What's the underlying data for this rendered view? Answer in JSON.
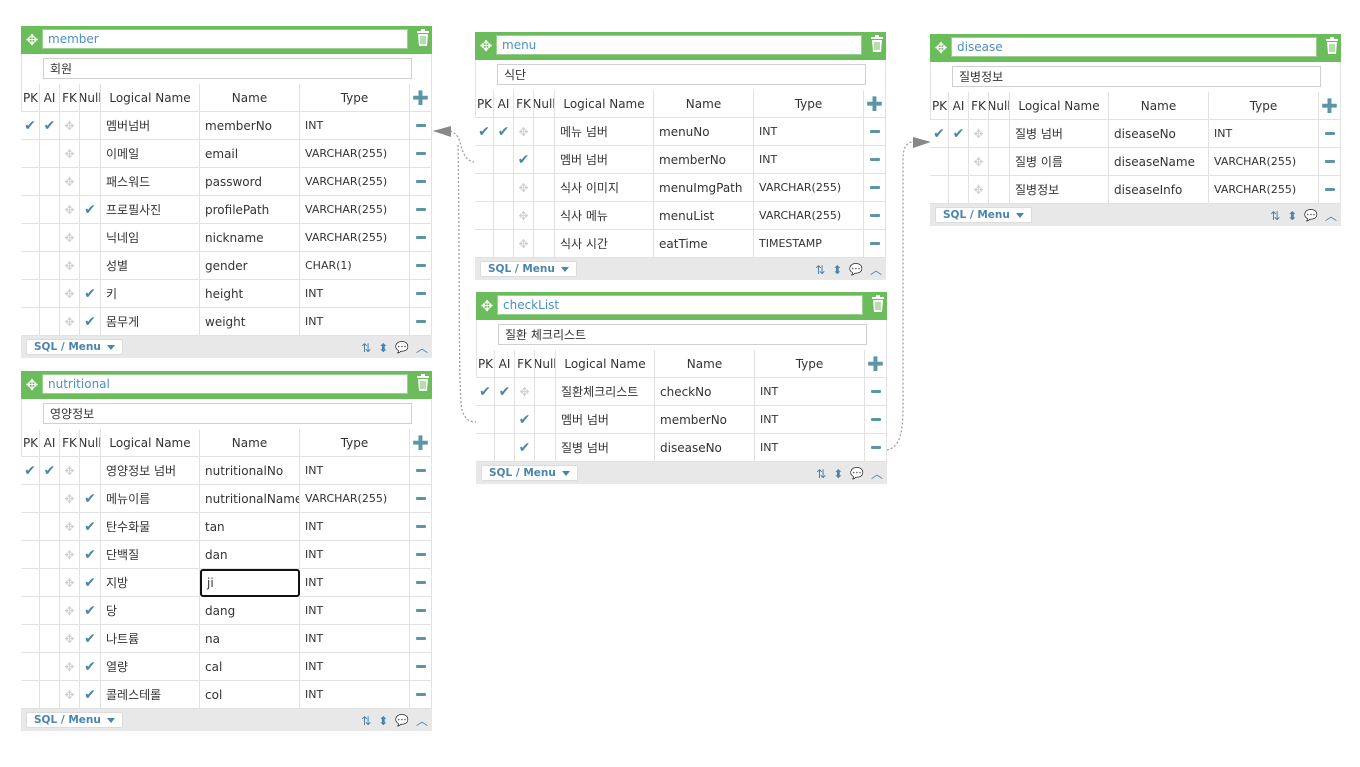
{
  "columns_header": {
    "pk": "PK",
    "ai": "AI",
    "fk": "FK",
    "null": "Null",
    "logical": "Logical Name",
    "name": "Name",
    "type": "Type"
  },
  "footer": {
    "sql_menu": "SQL / Menu"
  },
  "colors": {
    "header_green": "#6bbd5b",
    "accent_blue": "#4a86a7",
    "connector": "#999999"
  },
  "tables": [
    {
      "id": "member",
      "name": "member",
      "comment": "회원",
      "rows": [
        {
          "pk": true,
          "ai": true,
          "fk": false,
          "null": false,
          "logical": "멤버넘버",
          "name": "memberNo",
          "type": "INT"
        },
        {
          "pk": false,
          "ai": false,
          "fk": false,
          "null": false,
          "logical": "이메일",
          "name": "email",
          "type": "VARCHAR(255)"
        },
        {
          "pk": false,
          "ai": false,
          "fk": false,
          "null": false,
          "logical": "패스워드",
          "name": "password",
          "type": "VARCHAR(255)"
        },
        {
          "pk": false,
          "ai": false,
          "fk": false,
          "null": true,
          "logical": "프로필사진",
          "name": "profilePath",
          "type": "VARCHAR(255)"
        },
        {
          "pk": false,
          "ai": false,
          "fk": false,
          "null": false,
          "logical": "닉네임",
          "name": "nickname",
          "type": "VARCHAR(255)"
        },
        {
          "pk": false,
          "ai": false,
          "fk": false,
          "null": false,
          "logical": "성별",
          "name": "gender",
          "type": "CHAR(1)"
        },
        {
          "pk": false,
          "ai": false,
          "fk": false,
          "null": true,
          "logical": "키",
          "name": "height",
          "type": "INT"
        },
        {
          "pk": false,
          "ai": false,
          "fk": false,
          "null": true,
          "logical": "몸무게",
          "name": "weight",
          "type": "INT"
        }
      ]
    },
    {
      "id": "nutritional",
      "name": "nutritional",
      "comment": "영양정보",
      "rows": [
        {
          "pk": true,
          "ai": true,
          "fk": false,
          "null": false,
          "logical": "영양정보 넘버",
          "name": "nutritionalNo",
          "type": "INT"
        },
        {
          "pk": false,
          "ai": false,
          "fk": false,
          "null": true,
          "logical": "메뉴이름",
          "name": "nutritionalName",
          "type": "VARCHAR(255)"
        },
        {
          "pk": false,
          "ai": false,
          "fk": false,
          "null": true,
          "logical": "탄수화물",
          "name": "tan",
          "type": "INT"
        },
        {
          "pk": false,
          "ai": false,
          "fk": false,
          "null": true,
          "logical": "단백질",
          "name": "dan",
          "type": "INT"
        },
        {
          "pk": false,
          "ai": false,
          "fk": false,
          "null": true,
          "logical": "지방",
          "name": "ji",
          "type": "INT",
          "editing": true
        },
        {
          "pk": false,
          "ai": false,
          "fk": false,
          "null": true,
          "logical": "당",
          "name": "dang",
          "type": "INT"
        },
        {
          "pk": false,
          "ai": false,
          "fk": false,
          "null": true,
          "logical": "나트륨",
          "name": "na",
          "type": "INT"
        },
        {
          "pk": false,
          "ai": false,
          "fk": false,
          "null": true,
          "logical": "열량",
          "name": "cal",
          "type": "INT"
        },
        {
          "pk": false,
          "ai": false,
          "fk": false,
          "null": true,
          "logical": "콜레스테롤",
          "name": "col",
          "type": "INT"
        }
      ]
    },
    {
      "id": "menu",
      "name": "menu",
      "comment": "식단",
      "rows": [
        {
          "pk": true,
          "ai": true,
          "fk": false,
          "null": false,
          "logical": "메뉴 넘버",
          "name": "menuNo",
          "type": "INT"
        },
        {
          "pk": false,
          "ai": true,
          "fk": false,
          "null": false,
          "logical": "멤버 넘버",
          "name": "memberNo",
          "type": "INT",
          "fk_link": true
        },
        {
          "pk": false,
          "ai": false,
          "fk": false,
          "null": false,
          "logical": "식사 이미지",
          "name": "menuImgPath",
          "type": "VARCHAR(255)"
        },
        {
          "pk": false,
          "ai": false,
          "fk": false,
          "null": false,
          "logical": "식사 메뉴",
          "name": "menuList",
          "type": "VARCHAR(255)"
        },
        {
          "pk": false,
          "ai": false,
          "fk": false,
          "null": false,
          "logical": "식사 시간",
          "name": "eatTime",
          "type": "TIMESTAMP"
        }
      ]
    },
    {
      "id": "checklist",
      "name": "checkList",
      "comment": "질환 체크리스트",
      "rows": [
        {
          "pk": true,
          "ai": true,
          "fk": false,
          "null": false,
          "logical": "질환체크리스트",
          "name": "checkNo",
          "type": "INT"
        },
        {
          "pk": false,
          "ai": true,
          "fk": false,
          "null": false,
          "logical": "멤버 넘버",
          "name": "memberNo",
          "type": "INT",
          "fk_link": true
        },
        {
          "pk": false,
          "ai": true,
          "fk": false,
          "null": false,
          "logical": "질병 넘버",
          "name": "diseaseNo",
          "type": "INT",
          "fk_link": true
        }
      ]
    },
    {
      "id": "disease",
      "name": "disease",
      "comment": "질병정보",
      "rows": [
        {
          "pk": true,
          "ai": true,
          "fk": false,
          "null": false,
          "logical": "질병 넘버",
          "name": "diseaseNo",
          "type": "INT"
        },
        {
          "pk": false,
          "ai": false,
          "fk": false,
          "null": false,
          "logical": "질병 이름",
          "name": "diseaseName",
          "type": "VARCHAR(255)"
        },
        {
          "pk": false,
          "ai": false,
          "fk": false,
          "null": false,
          "logical": "질병정보",
          "name": "diseaseInfo",
          "type": "VARCHAR(255)"
        }
      ]
    }
  ],
  "icons": {
    "move": "move-icon",
    "trash": "trash-icon",
    "add": "plus-icon",
    "remove": "minus-icon",
    "check": "check-icon",
    "sort": "sort-icon",
    "updown": "up-down-icon",
    "comment": "comment-icon",
    "collapse": "chevron-up-icon",
    "dropdown": "caret-down-icon"
  }
}
